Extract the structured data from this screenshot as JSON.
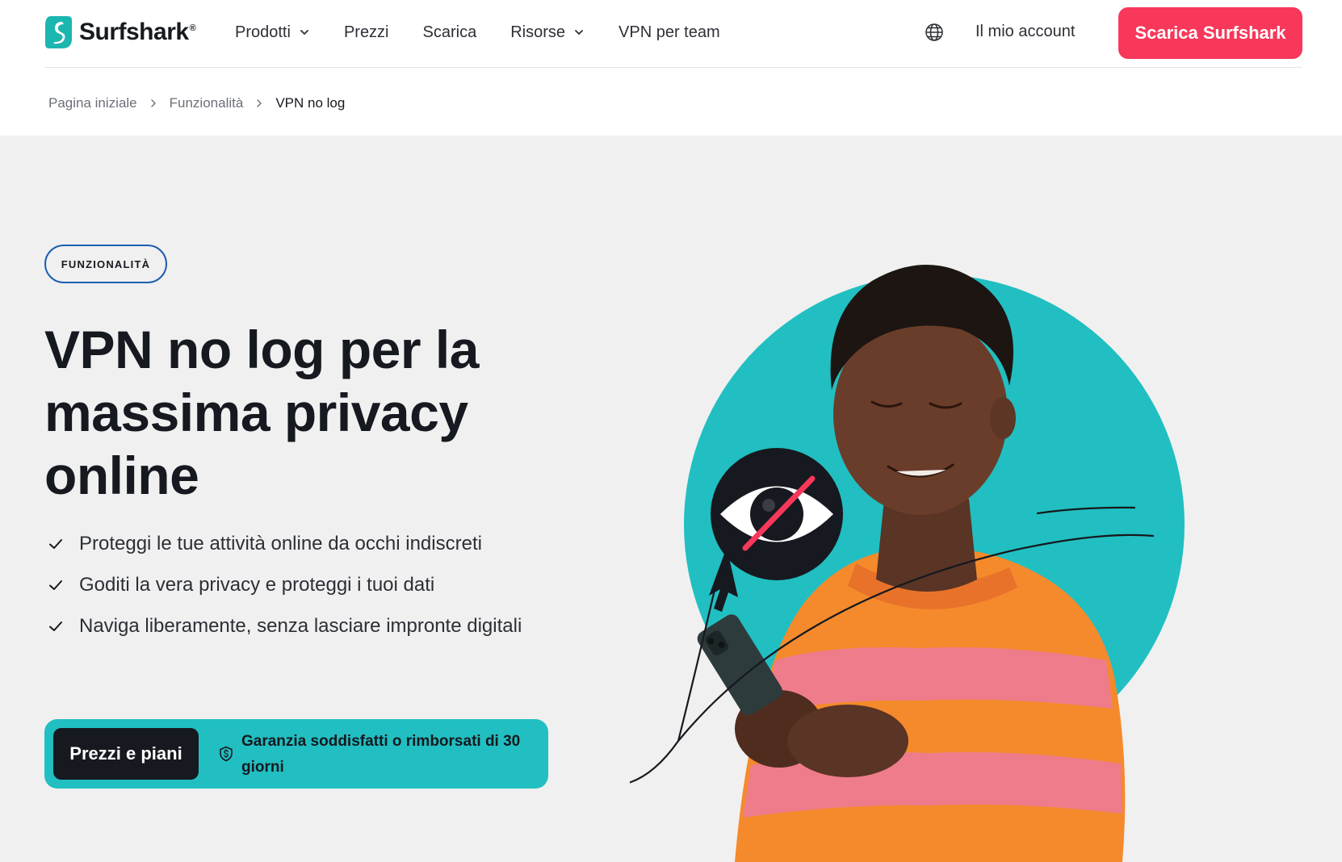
{
  "header": {
    "logo_text": "Surfshark",
    "logo_reg": "®",
    "nav": [
      {
        "label": "Prodotti",
        "has_dropdown": true
      },
      {
        "label": "Prezzi",
        "has_dropdown": false
      },
      {
        "label": "Scarica",
        "has_dropdown": false
      },
      {
        "label": "Risorse",
        "has_dropdown": true
      },
      {
        "label": "VPN per team",
        "has_dropdown": false
      }
    ],
    "language_icon": "globe-icon",
    "account_label": "Il mio account",
    "cta_label": "Scarica Surfshark"
  },
  "breadcrumb": [
    "Pagina iniziale",
    "Funzionalità",
    "VPN no log"
  ],
  "hero": {
    "badge": "FUNZIONALITÀ",
    "title": "VPN no log per la massima privacy online",
    "features": [
      "Proteggi le tue attività online da occhi indiscreti",
      "Goditi la vera privacy e proteggi i tuoi dati",
      "Naviga liberamente, senza lasciare impronte digitali"
    ],
    "cta_label": "Prezzi e piani",
    "guarantee": "Garanzia soddisfatti o rimborsati di 30 giorni"
  },
  "colors": {
    "brand_red": "#f7385b",
    "teal": "#21bfc1",
    "dark": "#16191f",
    "badge_border": "#1e5eb0",
    "hero_bg": "#f0f0f0"
  }
}
